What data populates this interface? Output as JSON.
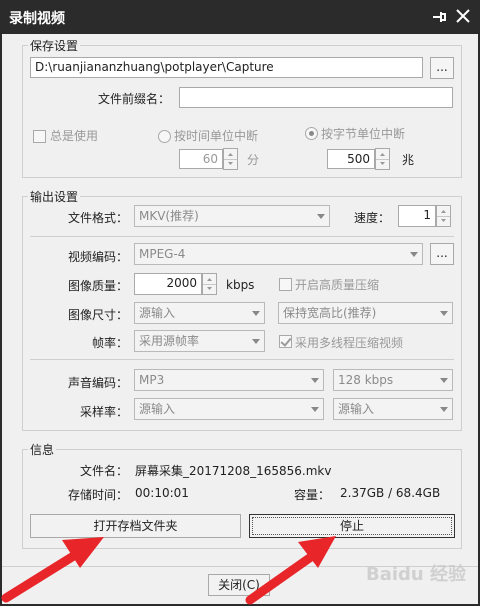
{
  "window": {
    "title": "录制视频"
  },
  "save": {
    "legend": "保存设置",
    "path": "D:\\ruanjiananzhuang\\potplayer\\Capture",
    "browse_label": "...",
    "prefix_label": "文件前缀名：",
    "prefix_value": "",
    "always_use": "总是使用",
    "by_time": "按时间单位中断",
    "by_size": "按字节单位中断",
    "time_value": "60",
    "time_unit": "分",
    "size_value": "500",
    "size_unit": "兆"
  },
  "output": {
    "legend": "输出设置",
    "format_label": "文件格式：",
    "format_value": "MKV(推荐)",
    "speed_label": "速度：",
    "speed_value": "1",
    "video_codec_label": "视频编码：",
    "video_codec_value": "MPEG-4",
    "codec_more": "...",
    "quality_label": "图像质量：",
    "quality_value": "2000",
    "quality_unit": "kbps",
    "hq_label": "开启高质量压缩",
    "size_label": "图像尺寸：",
    "size_value": "源输入",
    "aspect_value": "保持宽高比(推荐)",
    "fps_label": "帧率：",
    "fps_value": "采用源帧率",
    "multithread_label": "采用多线程压缩视频",
    "audio_codec_label": "声音编码：",
    "audio_codec_value": "MP3",
    "bitrate_value": "128 kbps",
    "samplerate_label": "采样率：",
    "samplerate_value": "源输入",
    "samplerate_value2": "源输入"
  },
  "info": {
    "legend": "信息",
    "filename_label": "文件名：",
    "filename_value": "屏幕采集_20171208_165856.mkv",
    "time_label": "存储时间：",
    "time_value": "00:10:01",
    "capacity_label": "容量：",
    "capacity_value": "2.37GB / 68.4GB"
  },
  "buttons": {
    "open_folder": "打开存档文件夹",
    "stop": "停止",
    "close": "关闭(C)"
  },
  "watermark": "Baidu 经验",
  "colors": {
    "titlebar": "#2b2b2b",
    "annotation_arrow": "#e8262a"
  }
}
